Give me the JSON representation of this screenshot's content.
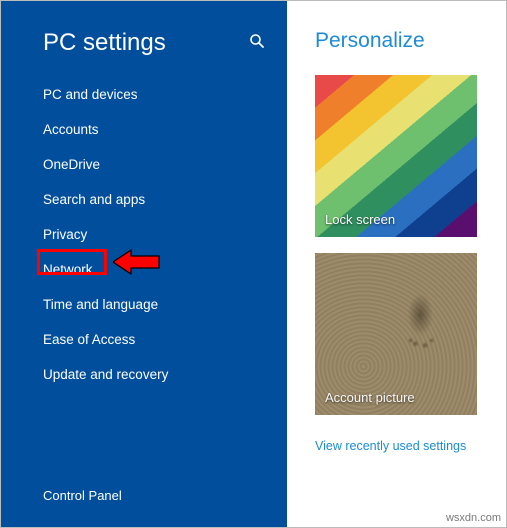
{
  "sidebar": {
    "title": "PC settings",
    "search_icon": "search-icon",
    "items": [
      {
        "label": "PC and devices"
      },
      {
        "label": "Accounts"
      },
      {
        "label": "OneDrive"
      },
      {
        "label": "Search and apps"
      },
      {
        "label": "Privacy"
      },
      {
        "label": "Network"
      },
      {
        "label": "Time and language"
      },
      {
        "label": "Ease of Access"
      },
      {
        "label": "Update and recovery"
      }
    ],
    "footer": "Control Panel"
  },
  "content": {
    "title": "Personalize",
    "tiles": [
      {
        "key": "lock",
        "caption": "Lock screen"
      },
      {
        "key": "account",
        "caption": "Account picture"
      }
    ],
    "recent_link": "View recently used settings"
  },
  "annotation": {
    "highlight_item_index": 5
  },
  "watermark": "wsxdn.com",
  "colors": {
    "sidebar_bg": "#004e9c",
    "accent": "#1e8bd1",
    "highlight": "#ff0000"
  }
}
